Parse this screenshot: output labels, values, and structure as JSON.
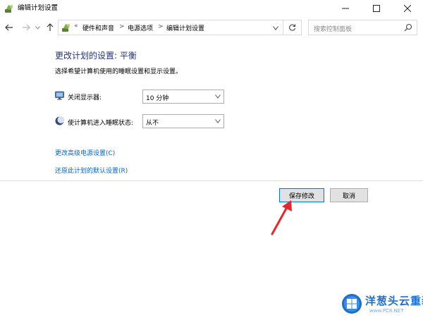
{
  "window": {
    "title": "编辑计划设置",
    "controls": [
      "minimize",
      "maximize",
      "close"
    ]
  },
  "nav": {
    "back_icon": "back-arrow-icon",
    "forward_icon": "forward-arrow-icon",
    "up_icon": "up-arrow-icon",
    "overflow": "«",
    "breadcrumbs": [
      "硬件和声音",
      "电源选项",
      "编辑计划设置"
    ],
    "separator": ">",
    "search_placeholder": "搜索控制面板"
  },
  "main": {
    "title": "更改计划的设置: 平衡",
    "description": "选择希望计算机使用的睡眠设置和显示设置。",
    "settings": [
      {
        "label": "关闭显示器:",
        "icon": "monitor-icon",
        "value": "10 分钟"
      },
      {
        "label": "使计算机进入睡眠状态:",
        "icon": "moon-icon",
        "value": "从不"
      }
    ],
    "links": [
      "更改高级电源设置(C)",
      "还原此计划的默认设置(R)"
    ]
  },
  "buttons": {
    "save": "保存修改",
    "cancel": "取消"
  },
  "watermark": {
    "title": "洋葱头云重装",
    "subtitle": "www.PC8.NET"
  },
  "colors": {
    "title_blue": "#1e3287",
    "link_blue": "#0066cc",
    "annotation_red": "#e8262b",
    "watermark_blue": "#1c6fd1"
  }
}
